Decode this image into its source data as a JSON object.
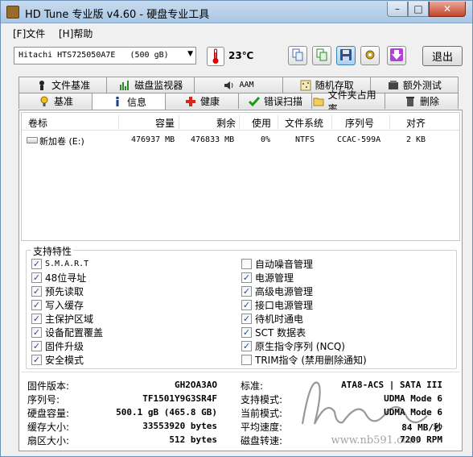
{
  "window": {
    "title": "HD Tune 专业版 v4.60 - 硬盘专业工具"
  },
  "window_controls": {
    "minimize": "–",
    "maximize": "□",
    "close": "✕"
  },
  "menu": {
    "file": "[F]文件",
    "help": "[H]帮助"
  },
  "toolbar": {
    "drive_selected": "Hitachi HTS725050A7E   (500 gB)",
    "temperature": "23℃",
    "exit": "退出"
  },
  "tabs_top": [
    {
      "label": "文件基准",
      "icon": "file-benchmark-icon"
    },
    {
      "label": "磁盘监视器",
      "icon": "disk-monitor-icon"
    },
    {
      "label": "AAM",
      "icon": "speaker-icon"
    },
    {
      "label": "随机存取",
      "icon": "random-access-icon"
    },
    {
      "label": "额外测试",
      "icon": "extra-tests-icon"
    }
  ],
  "tabs_bottom": [
    {
      "label": "基准",
      "icon": "benchmark-icon"
    },
    {
      "label": "信息",
      "icon": "info-icon"
    },
    {
      "label": "健康",
      "icon": "health-icon"
    },
    {
      "label": "错误扫描",
      "icon": "error-scan-icon"
    },
    {
      "label": "文件夹占用率",
      "icon": "folder-usage-icon"
    },
    {
      "label": "删除",
      "icon": "erase-icon"
    }
  ],
  "volume_table": {
    "headers": [
      "卷标",
      "容量",
      "剩余",
      "使用",
      "文件系统",
      "序列号",
      "对齐"
    ],
    "rows": [
      {
        "name": "新加卷 (E:)",
        "capacity": "476937 MB",
        "free": "476833 MB",
        "usage": "0%",
        "fs": "NTFS",
        "serial": "CCAC-599A",
        "align": "2 KB"
      }
    ]
  },
  "features": {
    "title": "支持特性",
    "left": [
      {
        "label": "S.M.A.R.T",
        "checked": true,
        "mono": true
      },
      {
        "label": "48位寻址",
        "checked": true
      },
      {
        "label": "预先读取",
        "checked": true
      },
      {
        "label": "写入缓存",
        "checked": true
      },
      {
        "label": "主保护区域",
        "checked": true
      },
      {
        "label": "设备配置覆盖",
        "checked": true
      },
      {
        "label": "固件升级",
        "checked": true
      },
      {
        "label": "安全模式",
        "checked": true
      }
    ],
    "right": [
      {
        "label": "自动噪音管理",
        "checked": false
      },
      {
        "label": "电源管理",
        "checked": true
      },
      {
        "label": "高级电源管理",
        "checked": true
      },
      {
        "label": "接口电源管理",
        "checked": true
      },
      {
        "label": "待机时通电",
        "checked": true
      },
      {
        "label": "SCT 数据表",
        "checked": true
      },
      {
        "label": "原生指令序列 (NCQ)",
        "checked": true
      },
      {
        "label": "TRIM指令 (禁用删除通知)",
        "checked": false
      }
    ]
  },
  "info": {
    "left": [
      {
        "label": "固件版本:",
        "value": "GH2OA3AO"
      },
      {
        "label": "序列号:",
        "value": "TF1501Y9G3SR4F"
      },
      {
        "label": "硬盘容量:",
        "value": "500.1 gB (465.8 GB)"
      },
      {
        "label": "缓存大小:",
        "value": "33553920 bytes"
      },
      {
        "label": "扇区大小:",
        "value": "512 bytes"
      }
    ],
    "right": [
      {
        "label": "标准:",
        "value": "ATA8-ACS | SATA III"
      },
      {
        "label": "支持模式:",
        "value": "UDMA Mode 6"
      },
      {
        "label": "当前模式:",
        "value": "UDMA Mode 6"
      },
      {
        "label": "平均速度:",
        "value": "84 MB/秒"
      },
      {
        "label": "磁盘转速:",
        "value": "7200 RPM"
      }
    ]
  },
  "watermark": {
    "signature": "hLonlue",
    "url": "www.nb591.com"
  }
}
